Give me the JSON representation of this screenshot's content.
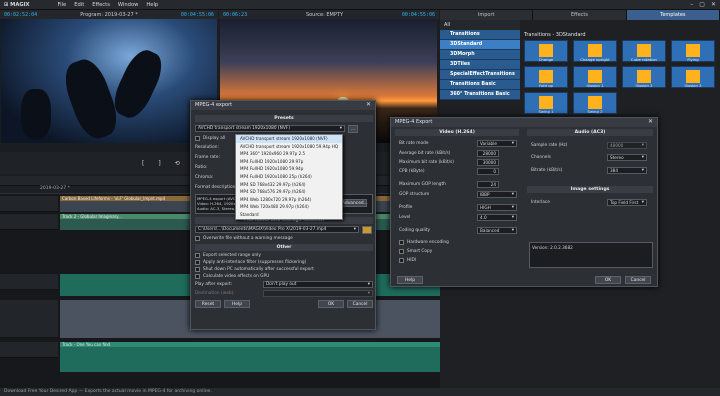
{
  "app": {
    "logo": "⊞ MAGIX",
    "menu": [
      "File",
      "Edit",
      "Effects",
      "Window",
      "Help"
    ]
  },
  "monitors": {
    "program_tc_left": "00:02:52:04",
    "program_caption": "Program: 2019-03-27 *",
    "program_tc_right": "00:04:55:06",
    "source_tc_left": "00:06:23",
    "source_caption": "Source: EMPTY",
    "source_tc_right": "00:04:55:06"
  },
  "transport": {
    "buttons": [
      "[",
      "]",
      "⟲",
      "|◀",
      "◀",
      "▶",
      "▶|",
      "■",
      "●"
    ]
  },
  "rightpanel": {
    "tabs": [
      "Import",
      "Effects",
      "Templates"
    ],
    "left_header": "All",
    "categories": [
      "Transitions",
      "3DStandard",
      "3DMorph",
      "3DTiles",
      "SpecialEffectTransitions",
      "Transitions Basic",
      "360° Transitions Basic"
    ],
    "trans_header": "Transitions - 3DStandard",
    "thumbs": [
      "Change",
      "Change upright",
      "Cube rotation",
      "Flying",
      "Fold up",
      "Illusion 1",
      "Illusion 2",
      "Illusion 3",
      "Swing 1",
      "Swing 2"
    ]
  },
  "timeline": {
    "project": "2019-03-27 *",
    "clip1": "Carbon Based Lifeforms - 'xLF' Globular_Impnt.mp4",
    "clip2": "Track 2 - Globular Imaginary...",
    "audio_label": "Track - One You can find",
    "audio_label2": "Track - One You can find"
  },
  "dialog1": {
    "title": "MPEG-4 export",
    "presets_header": "Presets",
    "preset_value": "AVCHD transport stream 1920x1080 (NVF)",
    "display_all": "Display all",
    "labels": [
      "Resolution:",
      "Frame rate:",
      "Ratio:",
      "Chroma:",
      "Format description:"
    ],
    "dropdown_items": [
      "AVCHD transport stream 1920x1080 (NVF)",
      "AVCHD transport stream 1920x1080 59.94p HQ",
      "MP4 360° 1920x960 29.97p 2.5",
      "MP4 FullHD 1920x1080 29.97p",
      "MP4 FullHD 1920x1080 59.94p",
      "MP4 FullHD 1920x1080 25p (h264)",
      "MP4 SD 768x432 29.97p (h264)",
      "MP4 SD 768x576 29.97p (h264)",
      "MP4 Web 1280x720 29.97p (h264)",
      "MP4 Web 720x480 29.97p (h264)",
      "Standard"
    ],
    "format_desc": "MPEG-4 export (AVC)\nVideo: H.264, 1920x1080, 29.97 frames/s, VBR 28000 kbit/s, hardware encoding\nAudio: AC-3, Stereo, 48000 Hz, 384 kbit/s",
    "file_header": "File name and storage location",
    "file_path": "C:\\Users\\...\\Documents\\MAGIX\\Video Pro X\\2019-03-27.mp4",
    "overwrite": "Overwrite file without a warning message",
    "other_header": "Other",
    "options": [
      "Export selected range only",
      "Apply anti-interlace filter (suppresses flickering)",
      "Shut down PC automatically after successful export",
      "Calculate video effects on GPU"
    ],
    "play_after_label": "Play after export:",
    "play_after_value": "Don't play out",
    "destination_label": "Destination (web):",
    "buttons": [
      "Reset",
      "Help",
      "OK",
      "Cancel"
    ],
    "advanced": "Advanced..."
  },
  "dialog2": {
    "title": "MPEG-4 Export",
    "video_header": "Video (H.264)",
    "audio_header": "Audio (AC3)",
    "video_fields": [
      {
        "label": "Bit rate mode",
        "value": "Variable"
      },
      {
        "label": "Average bit rate (kBit/s)",
        "value": "28000"
      },
      {
        "label": "Maximum bit rate (kBit/s)",
        "value": "30000"
      },
      {
        "label": "CPB (kByte)",
        "value": "0"
      },
      {
        "label": "Maximum GOP length",
        "value": "24"
      },
      {
        "label": "GOP structure",
        "value": "IBBP"
      },
      {
        "label": "Profile",
        "value": "HIGH"
      },
      {
        "label": "Level",
        "value": "4.0"
      },
      {
        "label": "Coding quality",
        "value": "Balanced"
      }
    ],
    "checks": [
      "Hardware encoding",
      "Smart Copy",
      "HIDI"
    ],
    "audio_fields": [
      {
        "label": "Sample rate (Hz)",
        "value": "48000"
      },
      {
        "label": "Channels",
        "value": "Stereo"
      },
      {
        "label": "Bitrate (kBit/s)",
        "value": "384"
      }
    ],
    "image_header": "Image settings",
    "interlace_label": "Interlace",
    "interlace_value": "Top Field First",
    "version": "Version: 2.0.2.3682",
    "buttons": [
      "Help",
      "OK",
      "Cancel"
    ]
  },
  "status": "Download Free Your Desired App  —  Exports the actual movie in MPEG-4 for archiving online."
}
